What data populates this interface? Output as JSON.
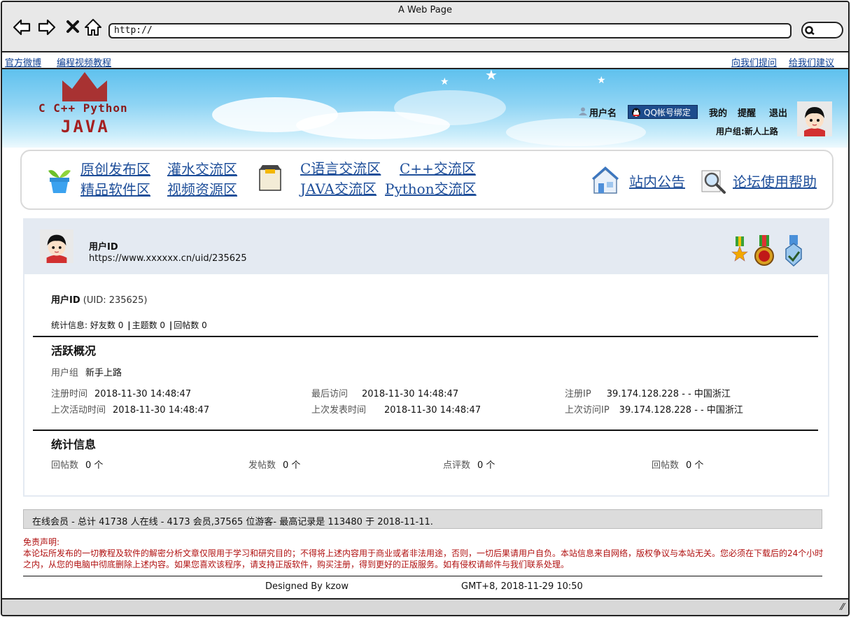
{
  "browser": {
    "window_title": "A Web Page",
    "url": "http://"
  },
  "topnav": {
    "left": [
      "官方微博",
      "编程视频教程"
    ],
    "right": [
      "向我们提问",
      "给我们建议"
    ]
  },
  "logo": {
    "line1": "C C++ Python",
    "line2": "JAVA",
    "color": "#a52020"
  },
  "userbar": {
    "username": "用户名",
    "qq_bind": "QQ帐号绑定",
    "my": "我的",
    "remind": "提醒",
    "logout": "退出",
    "usergroup": "用户组:新人上路"
  },
  "forumnav": {
    "group1": [
      "原创发布区",
      "灌水交流区",
      "精品软件区",
      "视频资源区"
    ],
    "group2": [
      "C语言交流区",
      "C++交流区",
      "JAVA交流区",
      "Python交流区"
    ],
    "announce": "站内公告",
    "help": "论坛使用帮助",
    "link_color": "#1f4f9a"
  },
  "profile": {
    "name": "用户ID",
    "url": "https://www.xxxxxx.cn/uid/235625",
    "name_line": "用户ID",
    "uid_text": "(UID: 235625)",
    "stats_prefix": "统计信息:",
    "friends_label": "好友数",
    "friends": "0",
    "topics_label": "主题数",
    "topics": "0",
    "replies_label": "回帖数",
    "replies": "0"
  },
  "activity": {
    "title": "活跃概况",
    "group_label": "用户组",
    "group_value": "新手上路",
    "reg_time_label": "注册时间",
    "reg_time": "2018-11-30 14:48:47",
    "last_active_label": "上次活动时间",
    "last_active": "2018-11-30 14:48:47",
    "last_visit_label": "最后访问",
    "last_visit": "2018-11-30 14:48:47",
    "last_post_label": "上次发表时间",
    "last_post": "2018-11-30 14:48:47",
    "reg_ip_label": "注册IP",
    "reg_ip": "39.174.128.228 - -  中国浙江",
    "last_ip_label": "上次访问IP",
    "last_ip": "39.174.128.228 - -  中国浙江"
  },
  "stats": {
    "title": "统计信息",
    "items": [
      {
        "label": "回帖数",
        "value": "0 个"
      },
      {
        "label": "发帖数",
        "value": "0 个"
      },
      {
        "label": "点评数",
        "value": "0 个"
      },
      {
        "label": "回帖数",
        "value": "0 个"
      }
    ]
  },
  "online": "在线会员 - 总计 41738 人在线 - 4173 会员,37565 位游客- 最高记录是 113480 于 2018-11-11.",
  "disclaimer": {
    "title": "免责声明:",
    "text": "本论坛所发布的一切教程及软件的解密分析文章仅限用于学习和研究目的；不得将上述内容用于商业或者非法用途，否则，一切后果请用户自负。本站信息来自网络，版权争议与本站无关。您必须在下载后的24个小时之内，从您的电脑中彻底删除上述内容。如果您喜欢该程序，请支持正版软件，购买注册，得到更好的正版服务。如有侵权请邮件与我们联系处理。",
    "color": "#b01010"
  },
  "footer": {
    "designed_by": "Designed By kzow",
    "time": "GMT+8, 2018-11-29 10:50"
  }
}
